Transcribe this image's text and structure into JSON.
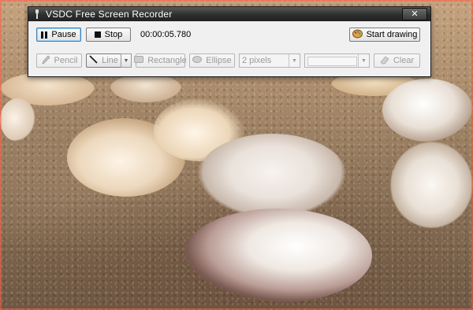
{
  "window": {
    "title": "VSDC Free Screen Recorder",
    "close_label": "✕"
  },
  "toolbar": {
    "pause_label": "Pause",
    "stop_label": "Stop",
    "timer": "00:00:05.780",
    "start_drawing_label": "Start drawing"
  },
  "drawing": {
    "pencil_label": "Pencil",
    "line_label": "Line",
    "rectangle_label": "Rectangle",
    "ellipse_label": "Ellipse",
    "width_value": "2 pixels",
    "color_value": "",
    "clear_label": "Clear"
  },
  "icons": {
    "app": "pin-icon",
    "pause": "pause-icon",
    "stop": "stop-icon",
    "start_drawing": "paint-palette-icon",
    "pencil": "pencil-icon",
    "line": "line-icon",
    "rectangle": "rectangle-icon",
    "ellipse": "ellipse-icon",
    "clear": "eraser-icon"
  },
  "colors": {
    "frame_border": "#ff5a46",
    "titlebar": "#2e2e2e",
    "focus_border": "#3c7fb1"
  }
}
